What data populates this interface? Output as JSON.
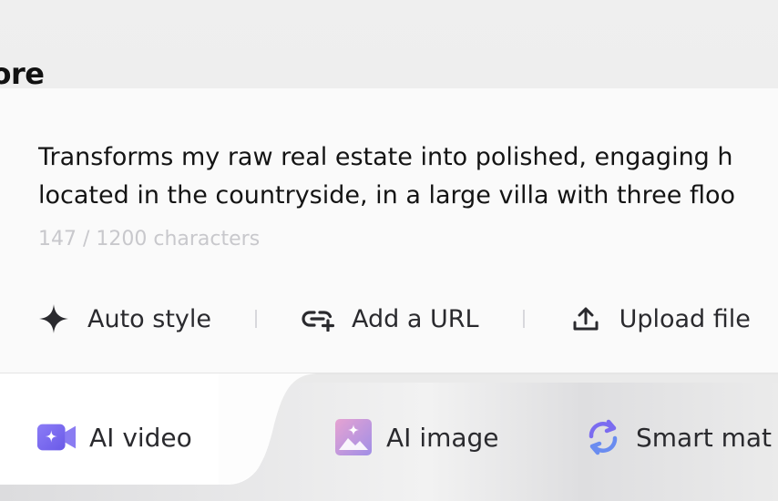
{
  "section": {
    "heading": "lore"
  },
  "prompt": {
    "line1": "Transforms my raw real estate into polished, engaging h",
    "line2": "located in the countryside, in a large villa with three floo",
    "counter": "147 / 1200 characters"
  },
  "toolbar": {
    "auto_style": "Auto style",
    "add_url": "Add a URL",
    "upload": "Upload file"
  },
  "tabs": {
    "ai_video": "AI video",
    "ai_image": "AI image",
    "smart": "Smart mat"
  },
  "colors": {
    "video_icon": "#7b6cf0",
    "image_icon_from": "#d99ad6",
    "image_icon_to": "#9b8ee8",
    "smart_icon": "#7b6cf0"
  }
}
